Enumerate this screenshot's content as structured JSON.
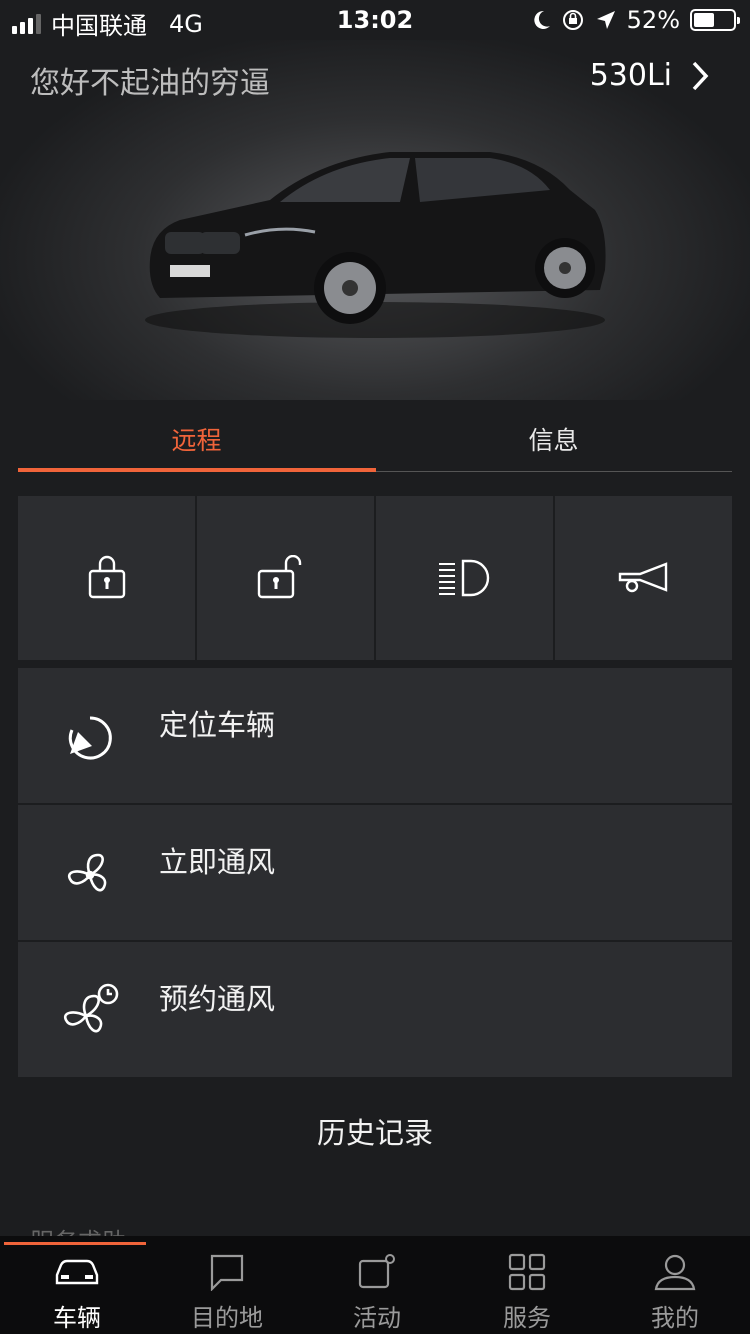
{
  "status": {
    "carrier": "中国联通",
    "network": "4G",
    "time": "13:02",
    "battery": "52%",
    "battery_level": 0.52
  },
  "header": {
    "greeting": "您好不起油的穷逼",
    "model": "530Li"
  },
  "tabs": [
    {
      "label": "远程"
    },
    {
      "label": "信息"
    }
  ],
  "quick_actions": [
    {
      "icon": "lock-icon"
    },
    {
      "icon": "unlock-icon"
    },
    {
      "icon": "headlight-icon"
    },
    {
      "icon": "horn-icon"
    }
  ],
  "list": [
    {
      "label": "定位车辆",
      "icon": "locate-icon"
    },
    {
      "label": "立即通风",
      "icon": "fan-icon"
    },
    {
      "label": "预约通风",
      "icon": "fan-schedule-icon"
    }
  ],
  "history_label": "历史记录",
  "peek_text": "服务求助",
  "bottom_nav": [
    {
      "label": "车辆",
      "icon": "car-icon"
    },
    {
      "label": "目的地",
      "icon": "destination-icon"
    },
    {
      "label": "活动",
      "icon": "activity-icon"
    },
    {
      "label": "服务",
      "icon": "grid-icon"
    },
    {
      "label": "我的",
      "icon": "profile-icon"
    }
  ],
  "colors": {
    "accent": "#f0643a",
    "background": "#1c1d1f",
    "card": "#2c2d30"
  }
}
